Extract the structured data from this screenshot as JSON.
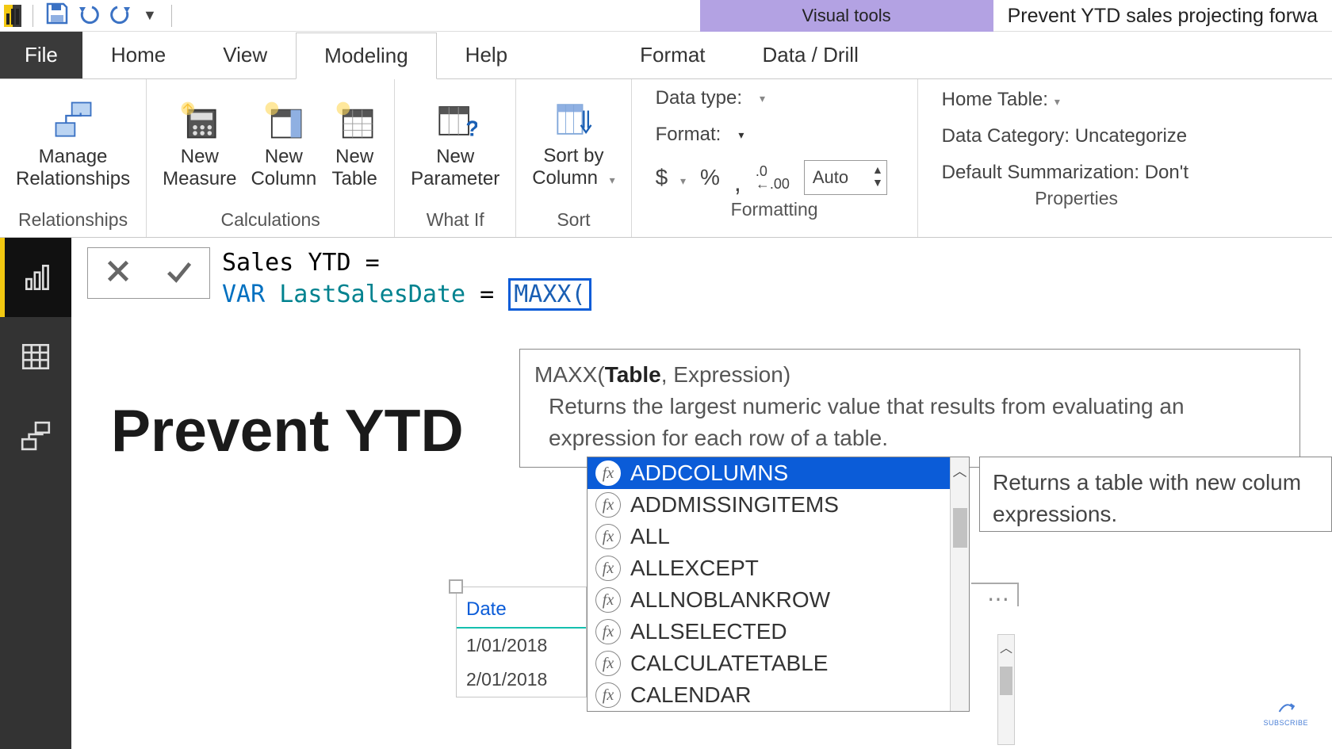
{
  "quick_access": {
    "app_icon": "powerbi-logo"
  },
  "context_tab": "Visual tools",
  "file_title": "Prevent YTD sales projecting forwa",
  "tabs": {
    "file": "File",
    "home": "Home",
    "view": "View",
    "modeling": "Modeling",
    "help": "Help",
    "format": "Format",
    "data_drill": "Data / Drill"
  },
  "ribbon": {
    "relationships": {
      "manage": "Manage\nRelationships",
      "group": "Relationships"
    },
    "calculations": {
      "new_measure": "New\nMeasure",
      "new_column": "New\nColumn",
      "new_table": "New\nTable",
      "group": "Calculations"
    },
    "whatif": {
      "new_parameter": "New\nParameter",
      "group": "What If"
    },
    "sort": {
      "sort_by_column": "Sort by\nColumn",
      "group": "Sort"
    },
    "formatting": {
      "data_type": "Data type:",
      "format": "Format:",
      "currency": "$",
      "percent": "%",
      "thousands": ",",
      "decimals_icon": ".0 .00",
      "auto": "Auto",
      "group": "Formatting"
    },
    "properties": {
      "home_table": "Home Table:",
      "data_category": "Data Category: Uncategorize",
      "default_summarization": "Default Summarization: Don't",
      "group": "Properties"
    }
  },
  "formula": {
    "line1_name": "Sales YTD",
    "line1_eq": "=",
    "line2_var": "VAR",
    "line2_varname": "LastSalesDate",
    "line2_eq": "=",
    "line2_func": "MAXX(",
    "signature_fn": "MAXX(",
    "signature_param1": "Table",
    "signature_rest": ", Expression)",
    "signature_desc": "Returns the largest numeric value that results from evaluating an expression for each row of a table."
  },
  "intellisense": {
    "items": [
      "ADDCOLUMNS",
      "ADDMISSINGITEMS",
      "ALL",
      "ALLEXCEPT",
      "ALLNOBLANKROW",
      "ALLSELECTED",
      "CALCULATETABLE",
      "CALENDAR"
    ],
    "selected_index": 0,
    "side_desc": "Returns a table with new colum expressions."
  },
  "canvas": {
    "page_title_prefix": "Prevent YTD",
    "date_table": {
      "header": "Date",
      "rows": [
        "1/01/2018",
        "2/01/2018"
      ]
    }
  },
  "subscribe": "SUBSCRIBE"
}
